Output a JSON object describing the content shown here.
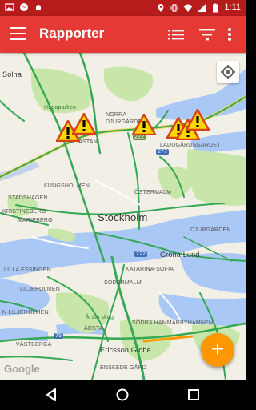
{
  "status_bar": {
    "time": "1:11"
  },
  "app_bar": {
    "title": "Rapporter",
    "actions": [
      "menu-icon",
      "list-view-icon",
      "filter-icon",
      "more-vert-icon"
    ]
  },
  "map": {
    "labels": {
      "solna": "Solna",
      "hagaparken": "Hagaparken",
      "norra": "NORRA",
      "djurgarden": "DJURGÅRDEN",
      "vasastan": "VASASTAN",
      "ladugardsgardet": "LADUGÅRDSGÄRDET",
      "kungsholmen": "KUNGSHOLMEN",
      "ostermalm": "ÖSTERMALM",
      "stadshagen": "STADSHAGEN",
      "kristineberg": "KRISTINEBERG",
      "mariaberg": "MARIEBERG",
      "stockholm": "Stockholm",
      "djurgarden2": "DJURGÅRDEN",
      "grona_lund": "Gröna Lund",
      "lilla_essingen": "LILLA ESSINGEN",
      "liljeholmen": "LILJEHOLMEN",
      "sodermalm": "SÖDERMALM",
      "katarina": "KATARINA-SOFIA",
      "n_liljeholmen": "N-LILJEHOLMEN",
      "arsta_skog": "Årsta skog",
      "arsta": "ÅRSTA",
      "sodra_hammarby": "SÖDRA HAMMARBYHAMNEN",
      "vastberga": "VÄSTBERGA",
      "ericsson": "Ericsson Globe",
      "enskede": "ENSKEDE GÅRD",
      "route_222a": "222",
      "route_222b": "222",
      "route_277": "277",
      "route_75": "75"
    },
    "google": "Google"
  },
  "fab": {
    "label": "+"
  },
  "colors": {
    "primary": "#e53935",
    "status": "#b71c1c",
    "accent": "#ff9800",
    "water": "#a9c8f5",
    "park": "#c8e6a9"
  }
}
